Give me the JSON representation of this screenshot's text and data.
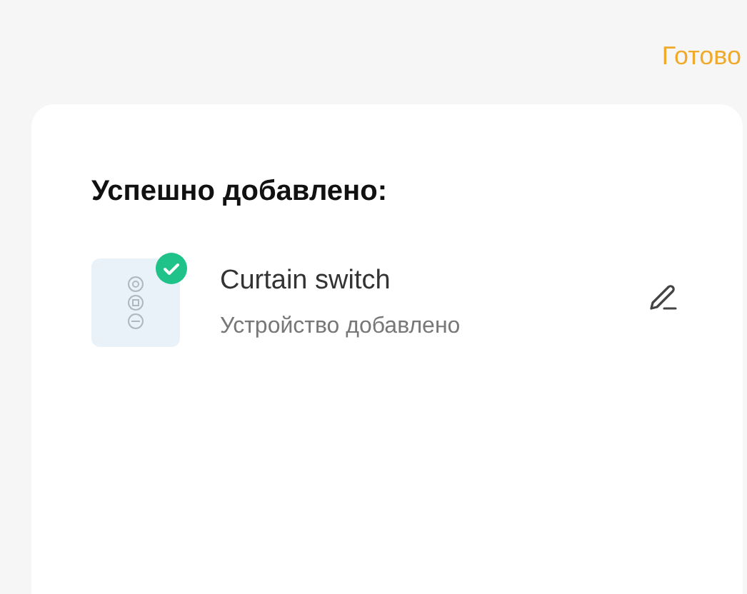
{
  "header": {
    "done_button": "Готово"
  },
  "card": {
    "title": "Успешно добавлено:",
    "devices": [
      {
        "name": "Curtain switch",
        "status": "Устройство добавлено",
        "added": true
      }
    ]
  }
}
